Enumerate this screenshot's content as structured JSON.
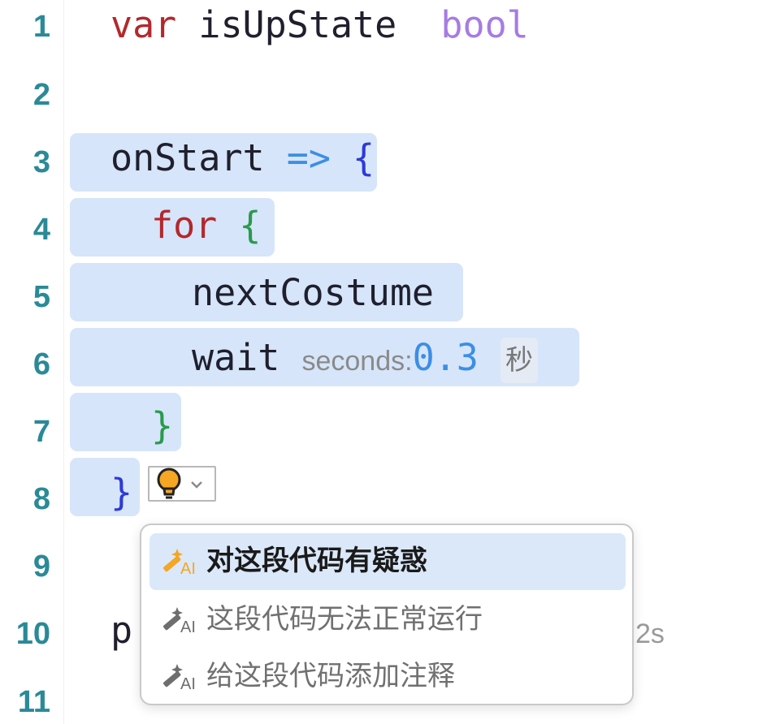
{
  "line_numbers": [
    "1",
    "2",
    "3",
    "4",
    "5",
    "6",
    "7",
    "8",
    "9",
    "10",
    "11"
  ],
  "code": {
    "line1": {
      "kw": "var",
      "name": "isUpState",
      "type": "bool"
    },
    "line3": {
      "name": "onStart",
      "arrow": "=>",
      "brace": "{"
    },
    "line4": {
      "kw": "for",
      "brace": "{"
    },
    "line5": {
      "call": "nextCostume"
    },
    "line6": {
      "call": "wait",
      "param": "seconds:",
      "value": "0.3",
      "unit": "秒"
    },
    "line7": {
      "brace": "}"
    },
    "line8": {
      "brace": "}"
    },
    "line10": {
      "partial": "p",
      "tail": "2s"
    }
  },
  "quick_fix": {
    "icon": "lightbulb-icon",
    "chevron": "chevron-down-icon"
  },
  "menu": {
    "items": [
      {
        "label": "对这段代码有疑惑",
        "icon": "ai-magic-icon"
      },
      {
        "label": "这段代码无法正常运行",
        "icon": "ai-magic-icon"
      },
      {
        "label": "给这段代码添加注释",
        "icon": "ai-magic-icon"
      }
    ]
  }
}
